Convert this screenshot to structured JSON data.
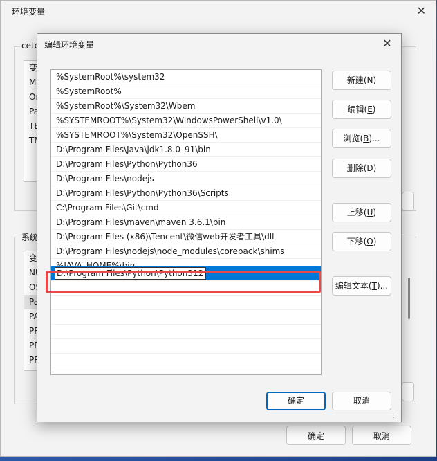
{
  "parent": {
    "title": "环境变量",
    "user_group": "cetc",
    "user_vars": [
      "变",
      "MI",
      "Or",
      "Pa",
      "TE",
      "TM"
    ],
    "system_group": "系统",
    "system_vars": [
      "变",
      "NU",
      "OS",
      "Pa",
      "PA",
      "PR",
      "PR",
      "PR"
    ],
    "ok_label": "确定",
    "cancel_label": "取消"
  },
  "dialog": {
    "title": "编辑环境变量",
    "paths": [
      "%SystemRoot%\\system32",
      "%SystemRoot%",
      "%SystemRoot%\\System32\\Wbem",
      "%SYSTEMROOT%\\System32\\WindowsPowerShell\\v1.0\\",
      "%SYSTEMROOT%\\System32\\OpenSSH\\",
      "D:\\Program Files\\Java\\jdk1.8.0_91\\bin",
      "D:\\Program Files\\Python\\Python36",
      "D:\\Program Files\\nodejs",
      "D:\\Program Files\\Python\\Python36\\Scripts",
      "C:\\Program Files\\Git\\cmd",
      "D:\\Program Files\\maven\\maven 3.6.1\\bin",
      "D:\\Program Files (x86)\\Tencent\\微信web开发者工具\\dll",
      "D:\\Program Files\\nodejs\\node_modules\\corepack\\shims",
      "%JAVA_HOME%\\bin"
    ],
    "editing_value": "D:\\Program Files\\Python\\Python312",
    "buttons": {
      "new": {
        "text": "新建(",
        "key": "N",
        "end": ")"
      },
      "edit": {
        "text": "编辑(",
        "key": "E",
        "end": ")"
      },
      "browse": {
        "text": "浏览(",
        "key": "B",
        "end": ")..."
      },
      "delete": {
        "text": "删除(",
        "key": "D",
        "end": ")"
      },
      "up": {
        "text": "上移(",
        "key": "U",
        "end": ")"
      },
      "down": {
        "text": "下移(",
        "key": "O",
        "end": ")"
      },
      "edit_text": {
        "text": "编辑文本(",
        "key": "T",
        "end": ")..."
      }
    },
    "ok_label": "确定",
    "cancel_label": "取消",
    "close_icon": "✕",
    "accent": "#0078d7",
    "highlight_color": "#e84a4a"
  }
}
